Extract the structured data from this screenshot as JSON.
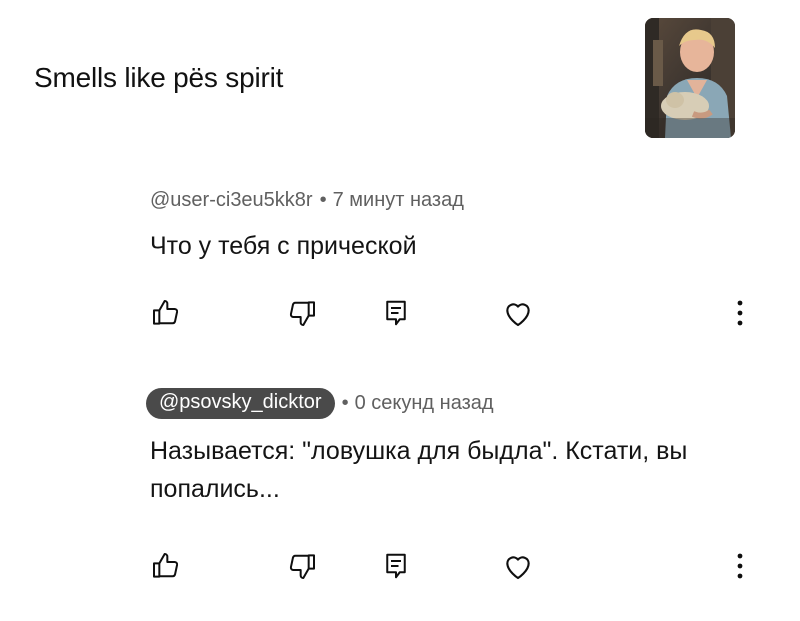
{
  "video": {
    "title": "Smells like pës spirit",
    "thumbnail_icon": "video-thumbnail-person-holding-cat"
  },
  "comments": [
    {
      "author": "@user-ci3eu5kk8r",
      "separator": "•",
      "time": "7 минут назад",
      "text": "Что у тебя с прической",
      "highlighted_author": false
    },
    {
      "author": "@psovsky_dicktor",
      "separator": "•",
      "time": "0 секунд назад",
      "text": "Называется: \"ловушка для быдла\". Кстати, вы попались...",
      "highlighted_author": true
    }
  ],
  "icons": {
    "like": "thumbs-up-icon",
    "dislike": "thumbs-down-icon",
    "reply": "reply-icon",
    "heart": "heart-icon",
    "more": "more-vertical-icon"
  },
  "colors": {
    "text": "#0f0f0f",
    "meta": "#606060",
    "pill_bg": "#4a4a4a",
    "pill_text": "#ffffff"
  }
}
